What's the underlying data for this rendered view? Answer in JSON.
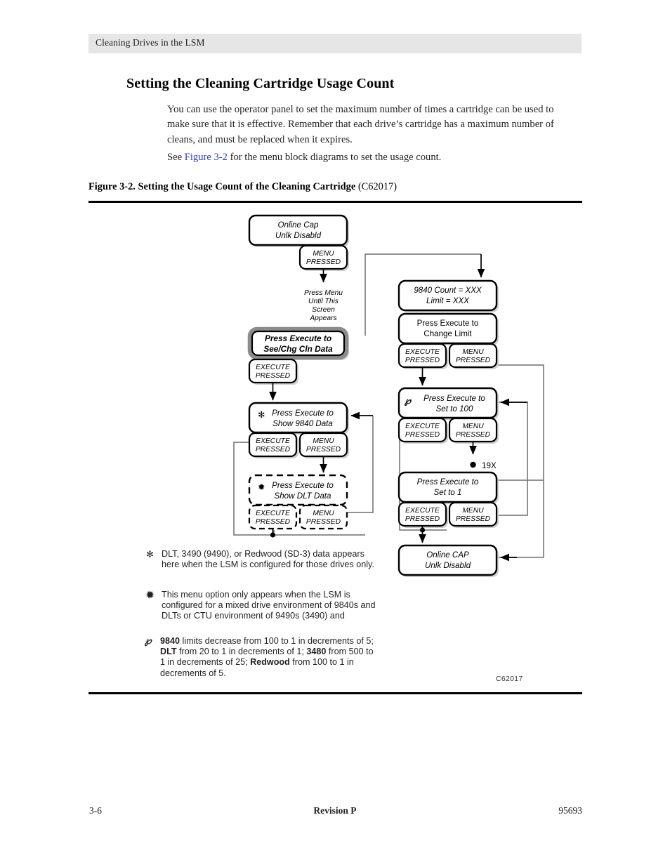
{
  "header": {
    "running_head": "Cleaning Drives in the LSM"
  },
  "heading": "Setting the Cleaning Cartridge Usage Count",
  "body": {
    "para1": "You can use the operator panel to set the maximum number of times a cartridge can be used to make sure that it is effective. Remember that each drive’s cartridge has a maximum number of cleans, and must be replaced when it expires.",
    "para2_before": "See ",
    "para2_link": "Figure 3-2",
    "para2_after": " for the menu block diagrams to set the usage count."
  },
  "figure": {
    "caption_bold": "Figure 3-2. Setting the Usage Count of the Cleaning Cartridge",
    "caption_plain": " (C62017)",
    "figure_id": "C62017"
  },
  "flow": {
    "left": {
      "start_box": {
        "line1": "Online Cap",
        "line2": "Unlk Disabld"
      },
      "menu_pressed_1": {
        "line1": "MENU",
        "line2": "PRESSED"
      },
      "press_menu_note": {
        "line1": "Press Menu",
        "line2": "Until This",
        "line3": "Screen",
        "line4": "Appears"
      },
      "highlight_box": {
        "line1": "Press Execute to",
        "line2": "See/Chg Cln Data"
      },
      "execute_pressed_1": {
        "line1": "EXECUTE",
        "line2": "PRESSED"
      },
      "show_9840_box": {
        "mark": "✻",
        "line1": "Press Execute to",
        "line2": "Show 9840 Data"
      },
      "execute_pressed_2": {
        "line1": "EXECUTE",
        "line2": "PRESSED"
      },
      "menu_pressed_2": {
        "line1": "MENU",
        "line2": "PRESSED"
      },
      "show_dlt_box": {
        "mark": "✹",
        "line1": "Press Execute to",
        "line2": "Show DLT Data"
      },
      "execute_pressed_3": {
        "line1": "EXECUTE",
        "line2": "PRESSED"
      },
      "menu_pressed_3": {
        "line1": "MENU",
        "line2": "PRESSED"
      }
    },
    "right": {
      "count_box": {
        "line1": "9840 Count = XXX",
        "line2": "Limit = XXX"
      },
      "change_limit_box": {
        "line1": "Press Execute to",
        "line2": "Change Limit"
      },
      "execute_pressed_4": {
        "line1": "EXECUTE",
        "line2": "PRESSED"
      },
      "menu_pressed_4": {
        "line1": "MENU",
        "line2": "PRESSED"
      },
      "set_to_100_box": {
        "mark": "℘",
        "line1": "Press Execute to",
        "line2": "Set to 100"
      },
      "execute_pressed_5": {
        "line1": "EXECUTE",
        "line2": "PRESSED"
      },
      "menu_pressed_5": {
        "line1": "MENU",
        "line2": "PRESSED"
      },
      "repeat_label": "19X",
      "set_to_1_box": {
        "line1": "Press Execute to",
        "line2": "Set to 1"
      },
      "execute_pressed_6": {
        "line1": "EXECUTE",
        "line2": "PRESSED"
      },
      "menu_pressed_6": {
        "line1": "MENU",
        "line2": "PRESSED"
      },
      "end_box": {
        "line1": "Online CAP",
        "line2": "Unlk Disabld"
      }
    }
  },
  "footnotes": {
    "note1": {
      "mark": "✻",
      "text": "DLT, 3490 (9490), or Redwood (SD-3) data appears here when the LSM is configured for those drives only."
    },
    "note2": {
      "mark": "✹",
      "text": "This menu option only appears when the LSM is configured for a mixed drive environment of 9840s and DLTs or CTU environment of 9490s (3490) and"
    },
    "note3": {
      "mark": "℘",
      "t1": "9840",
      "t2": " limits decrease from 100 to 1 in decrements of 5; ",
      "t3": "DLT",
      "t4": " from 20 to 1 in decrements of 1; ",
      "t5": "3480",
      "t6": " from 500 to 1 in decrements of 25; ",
      "t7": "Redwood",
      "t8": " from 100 to 1 in decrements of 5."
    }
  },
  "footer": {
    "page_number": "3-6",
    "revision": "Revision P",
    "doc_number": "95693"
  }
}
